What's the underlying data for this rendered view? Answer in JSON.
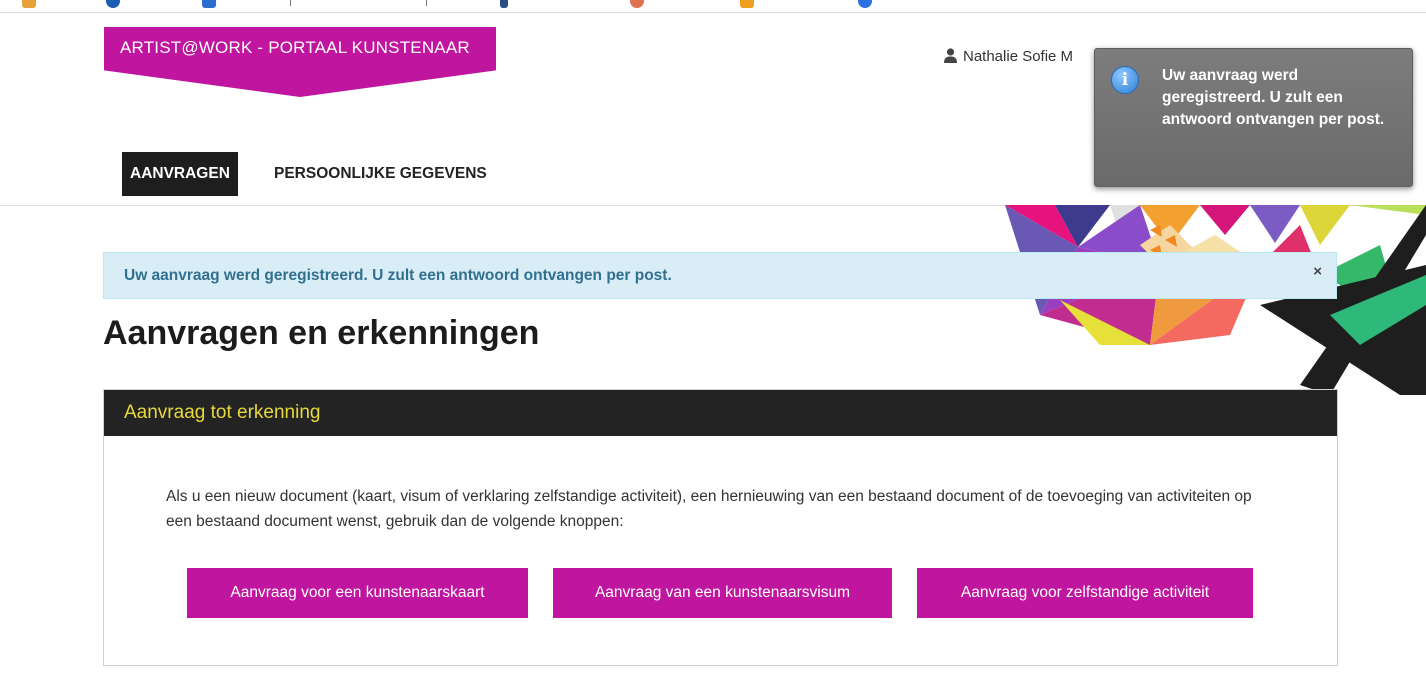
{
  "brand": {
    "title": "ARTIST@WORK - PORTAAL KUNSTENAAR",
    "color": "#c0159f"
  },
  "user": {
    "name": "Nathalie Sofie M",
    "icon": "user-icon"
  },
  "nav": {
    "items": [
      {
        "label": "AANVRAGEN",
        "active": true
      },
      {
        "label": "PERSOONLIJKE GEGEVENS",
        "active": false
      }
    ]
  },
  "alert": {
    "message": "Uw aanvraag werd geregistreerd. U zult een antwoord ontvangen per post.",
    "close": "×"
  },
  "page": {
    "title": "Aanvragen en erkenningen"
  },
  "panel": {
    "title": "Aanvraag tot erkenning",
    "body": "Als u een nieuw document (kaart, visum of verklaring zelfstandige activiteit), een hernieuwing van een bestaand document of de toevoeging van activiteiten op een bestaand document wenst, gebruik dan de volgende knoppen:",
    "buttons": [
      {
        "label": "Aanvraag voor een kunstenaarskaart"
      },
      {
        "label": "Aanvraag van een kunstenaarsvisum"
      },
      {
        "label": "Aanvraag voor zelfstandige activiteit"
      }
    ]
  },
  "toast": {
    "icon": "info-icon",
    "message": "Uw aanvraag werd geregistreerd. U zult een antwoord ontvangen per post."
  },
  "colors": {
    "accent": "#c0159f",
    "panel_header": "#232323",
    "panel_title": "#e6d93a",
    "alert_bg": "#d9edf7",
    "alert_text": "#31708f"
  }
}
